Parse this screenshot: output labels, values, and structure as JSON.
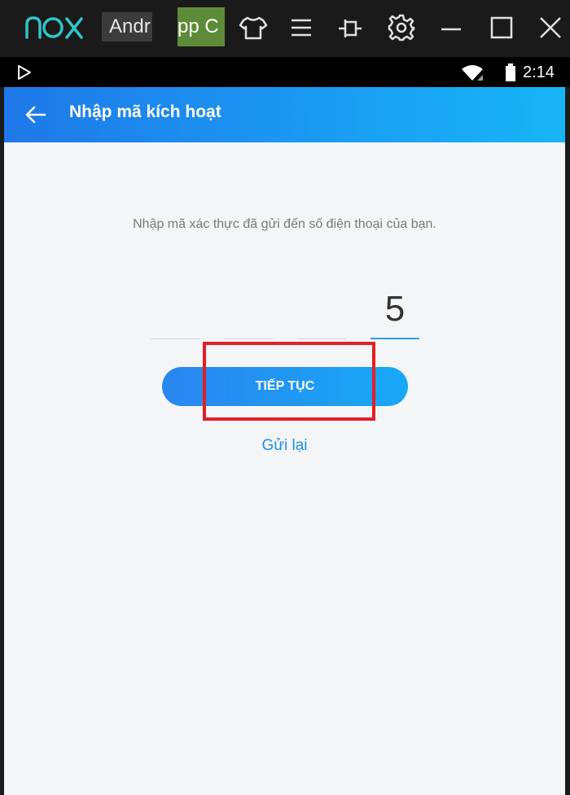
{
  "titlebar": {
    "logo_text": "nox",
    "tabs": [
      {
        "label": "Andr"
      },
      {
        "label": "pp C"
      }
    ],
    "tools": [
      {
        "icon": "shirt-icon"
      },
      {
        "icon": "menu-icon"
      },
      {
        "icon": "pin-icon"
      },
      {
        "icon": "gear-icon"
      },
      {
        "icon": "minimize-icon"
      },
      {
        "icon": "maximize-icon"
      },
      {
        "icon": "close-icon"
      }
    ],
    "colors": {
      "background": "#1a1a1a",
      "logo": "#2fc5c8",
      "app_tab": "#5e8b38"
    }
  },
  "statusbar": {
    "time": "2:14",
    "icons": [
      "play-store-icon",
      "wifi-icon",
      "battery-icon"
    ]
  },
  "app": {
    "header": {
      "title": "Nhập mã kích hoạt",
      "back_icon": "arrow-left-icon"
    },
    "instruction": "Nhập mã xác thực đã gửi đến số điện thoại của bạn.",
    "code": {
      "digits": [
        "",
        "",
        "",
        "5"
      ],
      "active_index": 3
    },
    "continue_label": "TIẾP TỤC",
    "resend_label": "Gửi lại",
    "colors": {
      "header_gradient": [
        "#1f78e9",
        "#18b5f6"
      ],
      "accent": "#2a9ef3",
      "highlight": "#e41e26",
      "background": "#f4f5f6"
    }
  }
}
